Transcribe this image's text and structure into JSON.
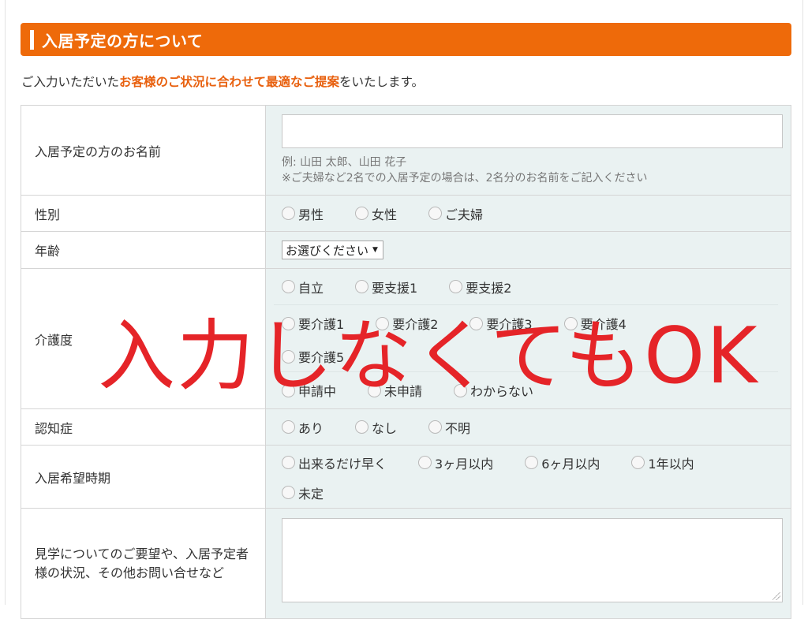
{
  "section": {
    "title": "入居予定の方について"
  },
  "intro": {
    "prefix": "ご入力いただいた",
    "emphasis": "お客様のご状況に合わせて最適なご提案",
    "suffix": "をいたします。"
  },
  "name": {
    "label": "入居予定の方のお名前",
    "placeholder": "",
    "hint1": "例: 山田 太郎、山田 花子",
    "hint2": "※ご夫婦など2名での入居予定の場合は、2名分のお名前をご記入ください"
  },
  "gender": {
    "label": "性別",
    "options": [
      "男性",
      "女性",
      "ご夫婦"
    ]
  },
  "age": {
    "label": "年齢",
    "selected": "お選びください"
  },
  "care": {
    "label": "介護度",
    "row1": [
      "自立",
      "要支援1",
      "要支援2"
    ],
    "row2": [
      "要介護1",
      "要介護2",
      "要介護3",
      "要介護4"
    ],
    "row3": [
      "要介護5"
    ],
    "row4": [
      "申請中",
      "未申請",
      "わからない"
    ]
  },
  "dementia": {
    "label": "認知症",
    "options": [
      "あり",
      "なし",
      "不明"
    ]
  },
  "timing": {
    "label": "入居希望時期",
    "options": [
      "出来るだけ早く",
      "3ヶ月以内",
      "6ヶ月以内",
      "1年以内",
      "未定"
    ]
  },
  "request": {
    "label": "見学についてのご要望や、入居予定者様の状況、その他お問い合せなど"
  },
  "overlay": {
    "text": "入力しなくてもOK"
  },
  "colors": {
    "accent": "#ee6a0a",
    "field_bg": "#eaf2f2",
    "overlay": "#e52428"
  }
}
